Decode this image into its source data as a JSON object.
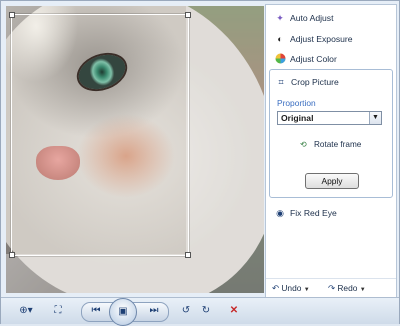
{
  "panel": {
    "items": [
      {
        "label": "Auto Adjust",
        "icon": "magic-wand-icon"
      },
      {
        "label": "Adjust Exposure",
        "icon": "exposure-icon"
      },
      {
        "label": "Adjust Color",
        "icon": "color-wheel-icon"
      }
    ],
    "crop": {
      "title": "Crop Picture",
      "proportion_label": "Proportion",
      "proportion_value": "Original",
      "rotate_label": "Rotate frame",
      "apply_label": "Apply"
    },
    "fix_red_eye": "Fix Red Eye",
    "undo_label": "Undo",
    "redo_label": "Redo"
  },
  "colors": {
    "accent": "#3a6ec1",
    "panel_bg": "#ffffff",
    "toolbar_bg": "#cfdbe9"
  }
}
